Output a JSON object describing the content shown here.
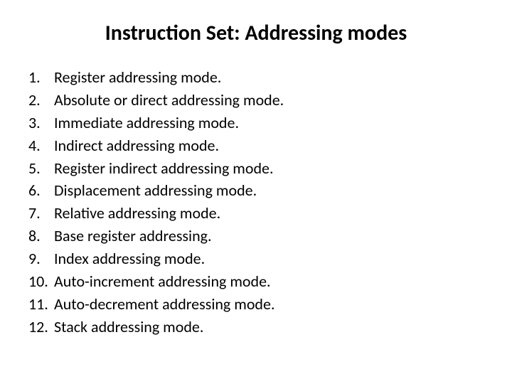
{
  "title": "Instruction Set: Addressing modes",
  "items": [
    {
      "num": "1.",
      "text": "Register addressing mode."
    },
    {
      "num": "2.",
      "text": "Absolute or direct addressing mode."
    },
    {
      "num": "3.",
      "text": "Immediate addressing mode."
    },
    {
      "num": "4.",
      "text": "Indirect addressing mode."
    },
    {
      "num": "5.",
      "text": "Register indirect addressing mode."
    },
    {
      "num": "6.",
      "text": "Displacement addressing mode."
    },
    {
      "num": "7.",
      "text": "Relative addressing mode."
    },
    {
      "num": "8.",
      "text": "Base register addressing."
    },
    {
      "num": "9.",
      "text": "Index addressing mode."
    },
    {
      "num": "10.",
      "text": "Auto-increment addressing mode."
    },
    {
      "num": "11.",
      "text": "Auto-decrement addressing mode."
    },
    {
      "num": "12.",
      "text": "Stack addressing mode."
    }
  ]
}
